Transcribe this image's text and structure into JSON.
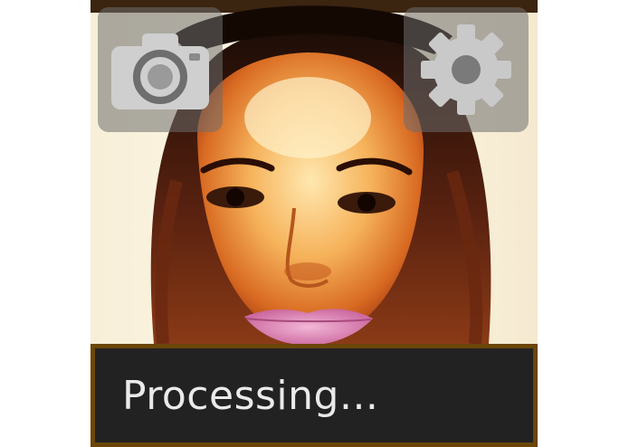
{
  "status": {
    "text": "Processing..."
  },
  "camera_button": {
    "icon": "camera-icon"
  },
  "settings_button": {
    "icon": "gear-icon"
  },
  "preview": {
    "subject": "face-photo"
  },
  "colors": {
    "status_background": "#222222",
    "status_border": "#6b4608",
    "status_text": "#eaeaea",
    "button_overlay": "rgba(110,110,110,0.55)",
    "icon_color": "#c9c9c9"
  }
}
